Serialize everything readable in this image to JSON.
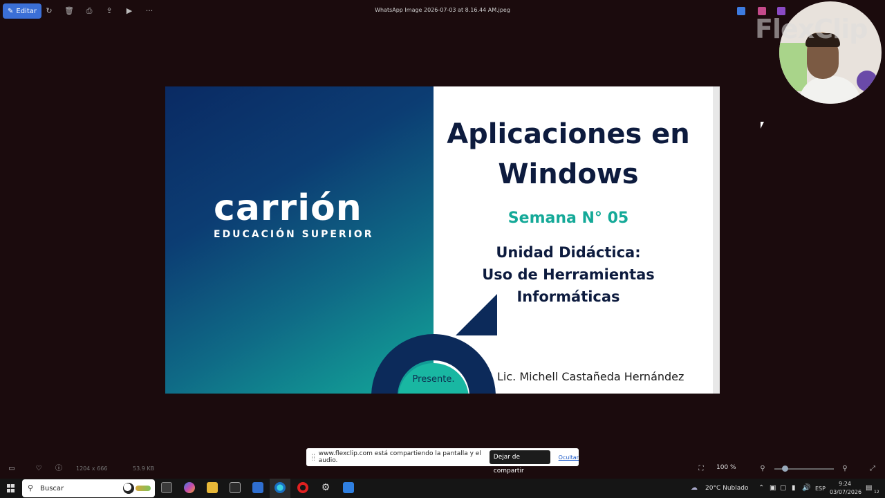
{
  "toolbar": {
    "edit_label": "Editar",
    "file_title": "WhatsApp Image 2026-07-03 at 8.16.44 AM.jpeg",
    "icons": [
      "rotate-icon",
      "delete-icon",
      "print-icon",
      "share-icon",
      "slideshow-icon",
      "more-icon"
    ]
  },
  "overlay": {
    "watermark": "FlexClip"
  },
  "slide": {
    "brand_name": "carrión",
    "brand_sub": "EDUCACIÓN SUPERIOR",
    "title_line1": "Aplicaciones en",
    "title_line2": "Windows",
    "week": "Semana N° 05",
    "unit_line1": "Unidad Didáctica:",
    "unit_line2": "Uso de Herramientas",
    "unit_line3": "Informáticas",
    "presente": "Presente.",
    "author": "Lic. Michell Castañeda Hernández",
    "colors": {
      "navy": "#0d1b3e",
      "teal": "#14a998"
    }
  },
  "viewer": {
    "dimensions": "1204 x 666",
    "file_size": "53.9 KB",
    "zoom": "100 %"
  },
  "share_banner": {
    "message": "www.flexclip.com está compartiendo la pantalla y el audio.",
    "stop_label": "Dejar de compartir",
    "hide_label": "Ocultar"
  },
  "taskbar": {
    "search_label": "Buscar",
    "weather": "20°C  Nublado",
    "language": "ESP",
    "time": "9:24",
    "date": "03/07/2026",
    "notifications": "12"
  }
}
